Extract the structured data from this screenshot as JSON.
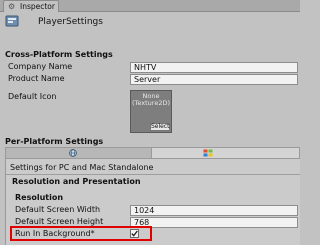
{
  "tab": {
    "label": "Inspector",
    "icon": "gear-icon"
  },
  "header": {
    "title": "PlayerSettings",
    "icon": "player-settings-icon"
  },
  "cross_platform": {
    "title": "Cross-Platform Settings",
    "company_name": {
      "label": "Company Name",
      "value": "NHTV"
    },
    "product_name": {
      "label": "Product Name",
      "value": "Server"
    },
    "default_icon": {
      "label": "Default Icon",
      "texture_line1": "None",
      "texture_line2": "(Texture2D)",
      "select_label": "Select"
    }
  },
  "per_platform": {
    "title": "Per-Platform Settings",
    "tabs": [
      {
        "icon": "globe-icon",
        "selected": false
      },
      {
        "icon": "windows-icon",
        "selected": true
      }
    ],
    "settings_for": "Settings for PC and Mac Standalone",
    "section_title": "Resolution and Presentation",
    "resolution": {
      "title": "Resolution",
      "screen_width": {
        "label": "Default Screen Width",
        "value": "1024"
      },
      "screen_height": {
        "label": "Default Screen Height",
        "value": "768"
      },
      "run_in_background": {
        "label": "Run In Background*",
        "checked": true
      }
    }
  },
  "colors": {
    "highlight": "#e00000"
  }
}
